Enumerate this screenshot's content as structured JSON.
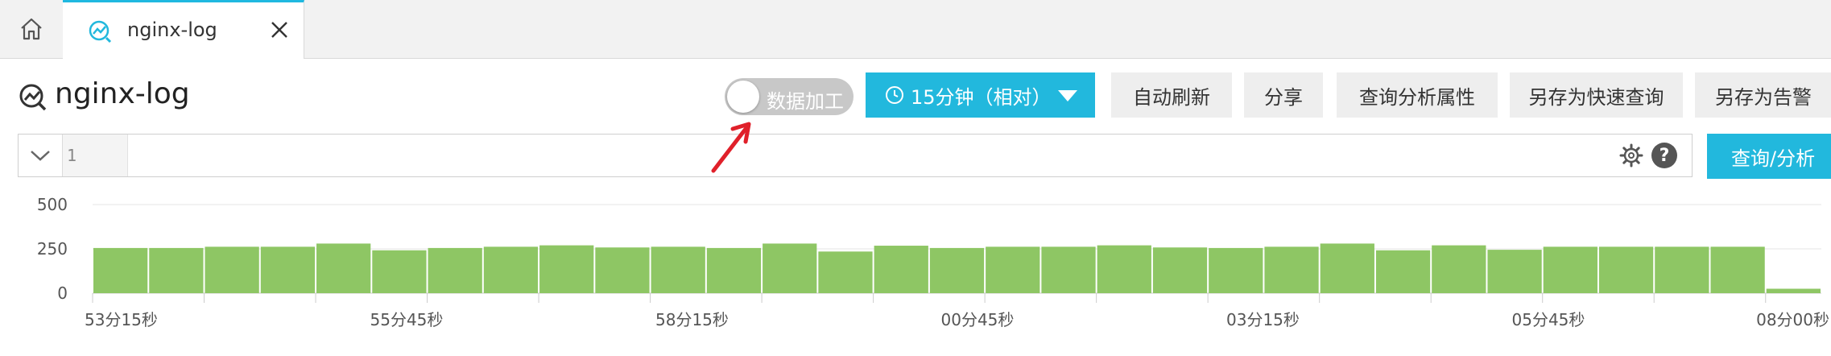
{
  "tabs": {
    "active_label": "nginx-log"
  },
  "header": {
    "title": "nginx-log",
    "toggle_label": "数据加工",
    "time_range": "15分钟（相对）",
    "buttons": [
      "自动刷新",
      "分享",
      "查询分析属性",
      "另存为快速查询",
      "另存为告警"
    ]
  },
  "query": {
    "line_number": "1",
    "help": "?",
    "submit_label": "查询/分析"
  },
  "colors": {
    "accent": "#22b8dd",
    "bar": "#8ec664"
  },
  "icons": [
    "home-icon",
    "chart-line-icon",
    "close-icon",
    "clock-icon",
    "chevron-down-icon",
    "gear-icon",
    "help-icon"
  ],
  "chart_data": {
    "type": "bar",
    "y_ticks": [
      "500",
      "250",
      "0"
    ],
    "ylim": [
      0,
      500
    ],
    "x_tick_labels": [
      "53分15秒",
      "55分45秒",
      "58分15秒",
      "00分45秒",
      "03分15秒",
      "05分45秒",
      "08分00秒"
    ],
    "values": [
      255,
      255,
      262,
      262,
      280,
      242,
      255,
      262,
      270,
      258,
      262,
      255,
      280,
      235,
      268,
      255,
      262,
      262,
      270,
      258,
      255,
      262,
      280,
      242,
      270,
      245,
      262,
      262,
      262,
      262,
      25
    ]
  }
}
